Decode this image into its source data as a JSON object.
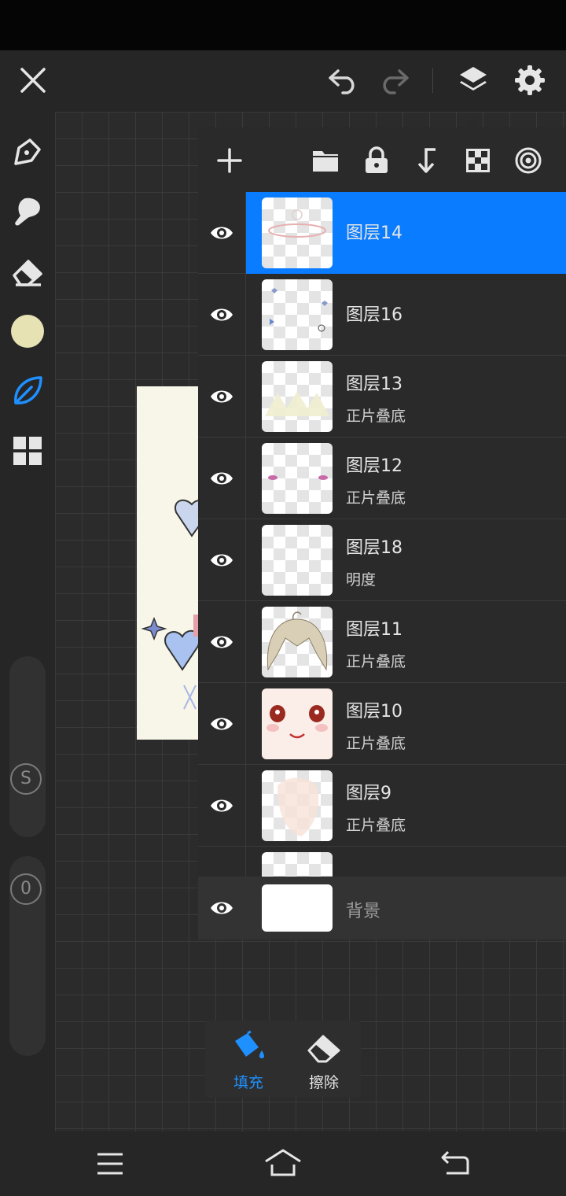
{
  "toolbar": {
    "left_tools": [
      "pen-icon",
      "smudge-icon",
      "eraser-icon",
      "color-swatch",
      "leaf-brush-icon",
      "grid-icon"
    ],
    "color_swatch": "#e6e2b4",
    "accent": "#1e90ff"
  },
  "sliders": {
    "size_label": "S",
    "opacity_label": "0"
  },
  "layers": {
    "selected_color": "#0a7cff",
    "items": [
      {
        "name": "图层14",
        "blend": ""
      },
      {
        "name": "图层16",
        "blend": ""
      },
      {
        "name": "图层13",
        "blend": "正片叠底"
      },
      {
        "name": "图层12",
        "blend": "正片叠底"
      },
      {
        "name": "图层18",
        "blend": "明度"
      },
      {
        "name": "图层11",
        "blend": "正片叠底"
      },
      {
        "name": "图层10",
        "blend": "正片叠底"
      },
      {
        "name": "图层9",
        "blend": "正片叠底"
      }
    ],
    "background_label": "背景"
  },
  "fill_popup": {
    "fill_label": "填充",
    "erase_label": "擦除"
  }
}
